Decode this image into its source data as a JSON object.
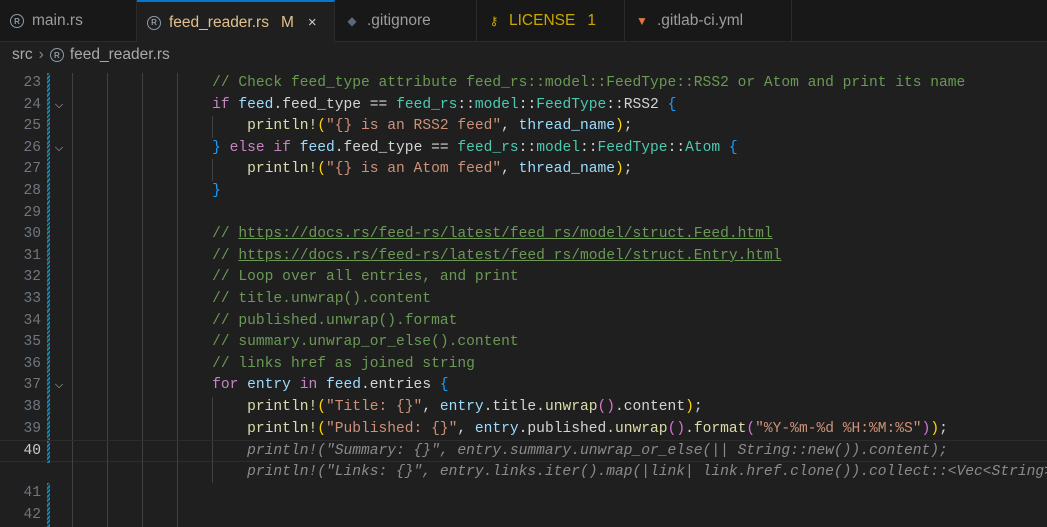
{
  "tabs": [
    {
      "label": "main.rs",
      "icon": "rust-icon",
      "color": "#9d9d9d"
    },
    {
      "label": "feed_reader.rs",
      "icon": "rust-icon",
      "badge": "M",
      "active": true,
      "color": "#e2c08d"
    },
    {
      "label": ".gitignore",
      "icon": "git-icon",
      "color": "#9d9d9d"
    },
    {
      "label": "LICENSE",
      "icon": "license-icon",
      "badge": "1",
      "color": "#cca700"
    },
    {
      "label": ".gitlab-ci.yml",
      "icon": "gitlab-icon",
      "color": "#9d9d9d"
    }
  ],
  "breadcrumb": {
    "folder": "src",
    "file": "feed_reader.rs"
  },
  "lines": [
    {
      "n": "23",
      "tokens": [
        [
          "p",
          "                "
        ],
        [
          "c",
          "// Check feed_type attribute feed_rs::model::FeedType::RSS2 or Atom and print its name"
        ]
      ]
    },
    {
      "n": "24",
      "fold": true,
      "tokens": [
        [
          "p",
          "                "
        ],
        [
          "k",
          "if "
        ],
        [
          "v",
          "feed"
        ],
        [
          "p",
          "."
        ],
        [
          "p",
          "feed_type == "
        ],
        [
          "t",
          "feed_rs"
        ],
        [
          "p",
          "::"
        ],
        [
          "t",
          "model"
        ],
        [
          "p",
          "::"
        ],
        [
          "t",
          "FeedType"
        ],
        [
          "p",
          "::RSS2 "
        ],
        [
          "b3",
          "{"
        ]
      ]
    },
    {
      "n": "25",
      "tokens": [
        [
          "p",
          "                    "
        ],
        [
          "f",
          "println!"
        ],
        [
          "b1",
          "("
        ],
        [
          "s",
          "\"{} is an RSS2 feed\""
        ],
        [
          "p",
          ", "
        ],
        [
          "v",
          "thread_name"
        ],
        [
          "b1",
          ")"
        ],
        [
          "p",
          ";"
        ]
      ]
    },
    {
      "n": "26",
      "fold": true,
      "tokens": [
        [
          "p",
          "                "
        ],
        [
          "b3",
          "}"
        ],
        [
          "k",
          " else if "
        ],
        [
          "v",
          "feed"
        ],
        [
          "p",
          ".feed_type == "
        ],
        [
          "t",
          "feed_rs"
        ],
        [
          "p",
          "::"
        ],
        [
          "t",
          "model"
        ],
        [
          "p",
          "::"
        ],
        [
          "t",
          "FeedType"
        ],
        [
          "p",
          "::"
        ],
        [
          "t",
          "Atom"
        ],
        [
          "p",
          " "
        ],
        [
          "b3",
          "{"
        ]
      ]
    },
    {
      "n": "27",
      "tokens": [
        [
          "p",
          "                    "
        ],
        [
          "f",
          "println!"
        ],
        [
          "b1",
          "("
        ],
        [
          "s",
          "\"{} is an Atom feed\""
        ],
        [
          "p",
          ", "
        ],
        [
          "v",
          "thread_name"
        ],
        [
          "b1",
          ")"
        ],
        [
          "p",
          ";"
        ]
      ]
    },
    {
      "n": "28",
      "tokens": [
        [
          "p",
          "                "
        ],
        [
          "b3",
          "}"
        ]
      ]
    },
    {
      "n": "29",
      "tokens": []
    },
    {
      "n": "30",
      "tokens": [
        [
          "p",
          "                "
        ],
        [
          "c",
          "// "
        ],
        [
          "u",
          "https://docs.rs/feed-rs/latest/feed_rs/model/struct.Feed.html"
        ]
      ]
    },
    {
      "n": "31",
      "tokens": [
        [
          "p",
          "                "
        ],
        [
          "c",
          "// "
        ],
        [
          "u",
          "https://docs.rs/feed-rs/latest/feed_rs/model/struct.Entry.html"
        ]
      ]
    },
    {
      "n": "32",
      "tokens": [
        [
          "p",
          "                "
        ],
        [
          "c",
          "// Loop over all entries, and print"
        ]
      ]
    },
    {
      "n": "33",
      "tokens": [
        [
          "p",
          "                "
        ],
        [
          "c",
          "// title.unwrap().content"
        ]
      ]
    },
    {
      "n": "34",
      "tokens": [
        [
          "p",
          "                "
        ],
        [
          "c",
          "// published.unwrap().format"
        ]
      ]
    },
    {
      "n": "35",
      "tokens": [
        [
          "p",
          "                "
        ],
        [
          "c",
          "// summary.unwrap_or_else().content"
        ]
      ]
    },
    {
      "n": "36",
      "tokens": [
        [
          "p",
          "                "
        ],
        [
          "c",
          "// links href as joined string"
        ]
      ]
    },
    {
      "n": "37",
      "fold": true,
      "tokens": [
        [
          "p",
          "                "
        ],
        [
          "k",
          "for "
        ],
        [
          "v",
          "entry"
        ],
        [
          "k",
          " in "
        ],
        [
          "v",
          "feed"
        ],
        [
          "p",
          ".entries "
        ],
        [
          "b3",
          "{"
        ]
      ]
    },
    {
      "n": "38",
      "tokens": [
        [
          "p",
          "                    "
        ],
        [
          "f",
          "println!"
        ],
        [
          "b1",
          "("
        ],
        [
          "s",
          "\"Title: {}\""
        ],
        [
          "p",
          ", "
        ],
        [
          "v",
          "entry"
        ],
        [
          "p",
          ".title."
        ],
        [
          "f",
          "unwrap"
        ],
        [
          "b2",
          "()"
        ],
        [
          "p",
          ".content"
        ],
        [
          "b1",
          ")"
        ],
        [
          "p",
          ";"
        ]
      ]
    },
    {
      "n": "39",
      "tokens": [
        [
          "p",
          "                    "
        ],
        [
          "f",
          "println!"
        ],
        [
          "b1",
          "("
        ],
        [
          "s",
          "\"Published: {}\""
        ],
        [
          "p",
          ", "
        ],
        [
          "v",
          "entry"
        ],
        [
          "p",
          ".published."
        ],
        [
          "f",
          "unwrap"
        ],
        [
          "b2",
          "()"
        ],
        [
          "p",
          "."
        ],
        [
          "f",
          "format"
        ],
        [
          "b2",
          "("
        ],
        [
          "s",
          "\"%Y-%m-%d %H:%M:%S\""
        ],
        [
          "b2",
          ")"
        ],
        [
          "b1",
          ")"
        ],
        [
          "p",
          ";"
        ]
      ]
    },
    {
      "n": "40",
      "current": true,
      "tokens": [
        [
          "p",
          "                    "
        ],
        [
          "g",
          "println!(\"Summary: {}\", entry.summary.unwrap_or_else(|| String::new()).content);"
        ]
      ]
    },
    {
      "n": "",
      "ghost": true,
      "tokens": [
        [
          "p",
          "                    "
        ],
        [
          "g",
          "println!(\"Links: {}\", entry.links.iter().map(|link| link.href.clone()).collect::<Vec<String>>"
        ]
      ]
    },
    {
      "n": "41",
      "tokens": []
    },
    {
      "n": "42",
      "tokens": []
    }
  ]
}
